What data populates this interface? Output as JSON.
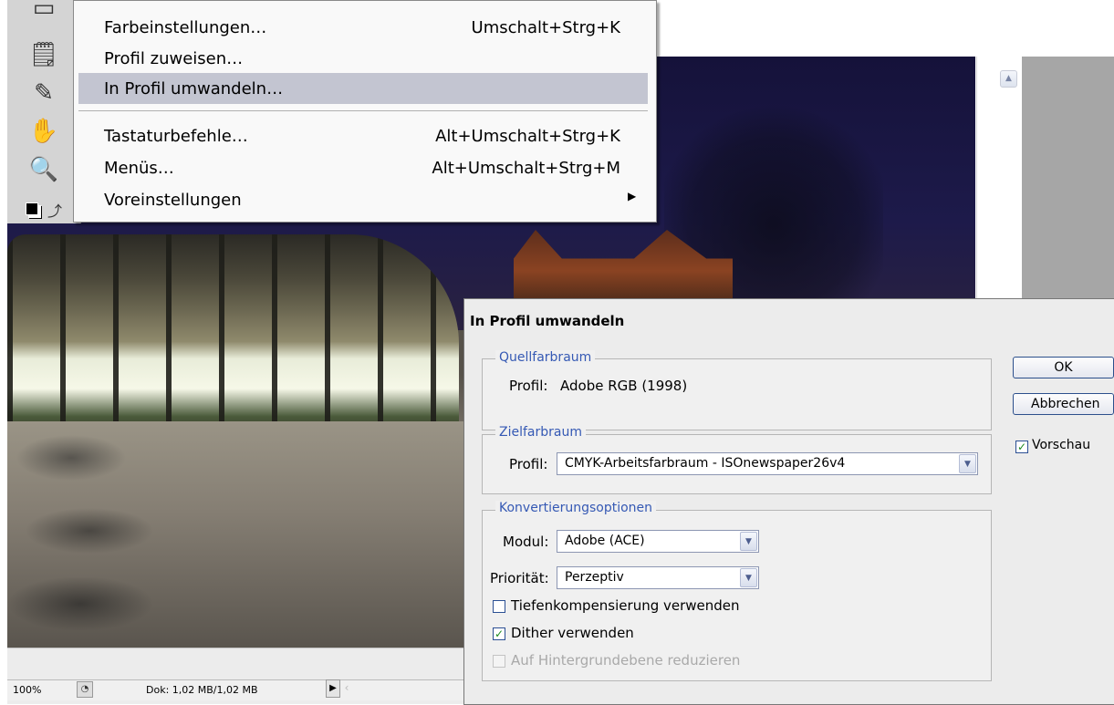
{
  "menu": {
    "items": [
      {
        "label": "Farbeinstellungen…",
        "shortcut": "Umschalt+Strg+K"
      },
      {
        "label": "Profil zuweisen…",
        "shortcut": ""
      },
      {
        "label": "In Profil umwandeln…",
        "shortcut": ""
      },
      {
        "label": "Tastaturbefehle…",
        "shortcut": "Alt+Umschalt+Strg+K"
      },
      {
        "label": "Menüs…",
        "shortcut": "Alt+Umschalt+Strg+M"
      },
      {
        "label": "Voreinstellungen",
        "shortcut": ""
      }
    ]
  },
  "status": {
    "zoom": "100%",
    "doc": "Dok: 1,02 MB/1,02 MB"
  },
  "dialog": {
    "title": "In Profil umwandeln",
    "source": {
      "legend": "Quellfarbraum",
      "profile_label": "Profil:",
      "profile_value": "Adobe RGB (1998)"
    },
    "target": {
      "legend": "Zielfarbraum",
      "profile_label": "Profil:",
      "profile_value": "CMYK-Arbeitsfarbraum - ISOnewspaper26v4"
    },
    "options": {
      "legend": "Konvertierungsoptionen",
      "module_label": "Modul:",
      "module_value": "Adobe (ACE)",
      "priority_label": "Priorität:",
      "priority_value": "Perzeptiv",
      "depth_label": "Tiefenkompensierung verwenden",
      "dither_label": "Dither verwenden",
      "flatten_label": "Auf Hintergrundebene reduzieren"
    },
    "ok_label": "OK",
    "cancel_label": "Abbrechen",
    "preview_label": "Vorschau"
  }
}
